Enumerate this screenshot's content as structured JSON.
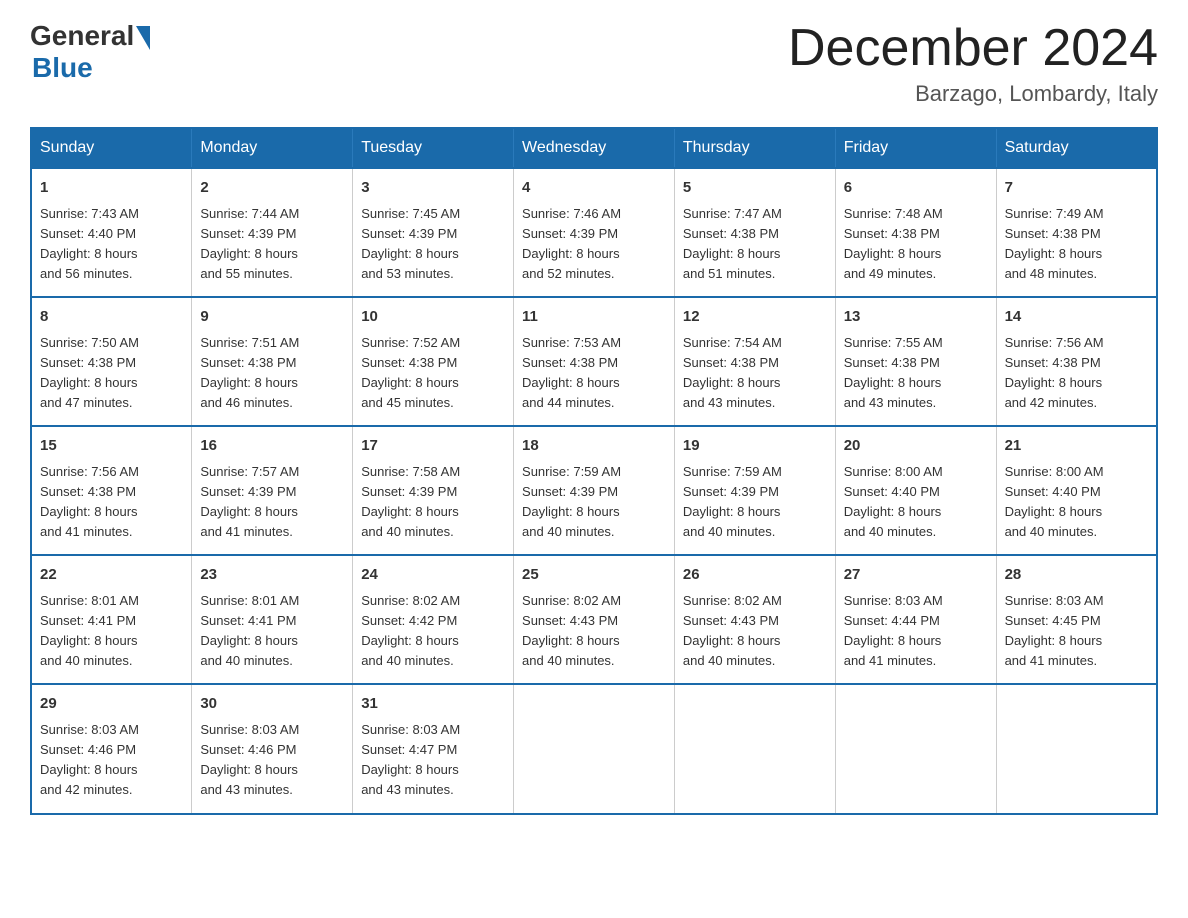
{
  "header": {
    "logo_general": "General",
    "logo_blue": "Blue",
    "month_title": "December 2024",
    "location": "Barzago, Lombardy, Italy"
  },
  "days_of_week": [
    "Sunday",
    "Monday",
    "Tuesday",
    "Wednesday",
    "Thursday",
    "Friday",
    "Saturday"
  ],
  "weeks": [
    [
      {
        "day": "1",
        "sunrise": "7:43 AM",
        "sunset": "4:40 PM",
        "daylight": "8 hours and 56 minutes."
      },
      {
        "day": "2",
        "sunrise": "7:44 AM",
        "sunset": "4:39 PM",
        "daylight": "8 hours and 55 minutes."
      },
      {
        "day": "3",
        "sunrise": "7:45 AM",
        "sunset": "4:39 PM",
        "daylight": "8 hours and 53 minutes."
      },
      {
        "day": "4",
        "sunrise": "7:46 AM",
        "sunset": "4:39 PM",
        "daylight": "8 hours and 52 minutes."
      },
      {
        "day": "5",
        "sunrise": "7:47 AM",
        "sunset": "4:38 PM",
        "daylight": "8 hours and 51 minutes."
      },
      {
        "day": "6",
        "sunrise": "7:48 AM",
        "sunset": "4:38 PM",
        "daylight": "8 hours and 49 minutes."
      },
      {
        "day": "7",
        "sunrise": "7:49 AM",
        "sunset": "4:38 PM",
        "daylight": "8 hours and 48 minutes."
      }
    ],
    [
      {
        "day": "8",
        "sunrise": "7:50 AM",
        "sunset": "4:38 PM",
        "daylight": "8 hours and 47 minutes."
      },
      {
        "day": "9",
        "sunrise": "7:51 AM",
        "sunset": "4:38 PM",
        "daylight": "8 hours and 46 minutes."
      },
      {
        "day": "10",
        "sunrise": "7:52 AM",
        "sunset": "4:38 PM",
        "daylight": "8 hours and 45 minutes."
      },
      {
        "day": "11",
        "sunrise": "7:53 AM",
        "sunset": "4:38 PM",
        "daylight": "8 hours and 44 minutes."
      },
      {
        "day": "12",
        "sunrise": "7:54 AM",
        "sunset": "4:38 PM",
        "daylight": "8 hours and 43 minutes."
      },
      {
        "day": "13",
        "sunrise": "7:55 AM",
        "sunset": "4:38 PM",
        "daylight": "8 hours and 43 minutes."
      },
      {
        "day": "14",
        "sunrise": "7:56 AM",
        "sunset": "4:38 PM",
        "daylight": "8 hours and 42 minutes."
      }
    ],
    [
      {
        "day": "15",
        "sunrise": "7:56 AM",
        "sunset": "4:38 PM",
        "daylight": "8 hours and 41 minutes."
      },
      {
        "day": "16",
        "sunrise": "7:57 AM",
        "sunset": "4:39 PM",
        "daylight": "8 hours and 41 minutes."
      },
      {
        "day": "17",
        "sunrise": "7:58 AM",
        "sunset": "4:39 PM",
        "daylight": "8 hours and 40 minutes."
      },
      {
        "day": "18",
        "sunrise": "7:59 AM",
        "sunset": "4:39 PM",
        "daylight": "8 hours and 40 minutes."
      },
      {
        "day": "19",
        "sunrise": "7:59 AM",
        "sunset": "4:39 PM",
        "daylight": "8 hours and 40 minutes."
      },
      {
        "day": "20",
        "sunrise": "8:00 AM",
        "sunset": "4:40 PM",
        "daylight": "8 hours and 40 minutes."
      },
      {
        "day": "21",
        "sunrise": "8:00 AM",
        "sunset": "4:40 PM",
        "daylight": "8 hours and 40 minutes."
      }
    ],
    [
      {
        "day": "22",
        "sunrise": "8:01 AM",
        "sunset": "4:41 PM",
        "daylight": "8 hours and 40 minutes."
      },
      {
        "day": "23",
        "sunrise": "8:01 AM",
        "sunset": "4:41 PM",
        "daylight": "8 hours and 40 minutes."
      },
      {
        "day": "24",
        "sunrise": "8:02 AM",
        "sunset": "4:42 PM",
        "daylight": "8 hours and 40 minutes."
      },
      {
        "day": "25",
        "sunrise": "8:02 AM",
        "sunset": "4:43 PM",
        "daylight": "8 hours and 40 minutes."
      },
      {
        "day": "26",
        "sunrise": "8:02 AM",
        "sunset": "4:43 PM",
        "daylight": "8 hours and 40 minutes."
      },
      {
        "day": "27",
        "sunrise": "8:03 AM",
        "sunset": "4:44 PM",
        "daylight": "8 hours and 41 minutes."
      },
      {
        "day": "28",
        "sunrise": "8:03 AM",
        "sunset": "4:45 PM",
        "daylight": "8 hours and 41 minutes."
      }
    ],
    [
      {
        "day": "29",
        "sunrise": "8:03 AM",
        "sunset": "4:46 PM",
        "daylight": "8 hours and 42 minutes."
      },
      {
        "day": "30",
        "sunrise": "8:03 AM",
        "sunset": "4:46 PM",
        "daylight": "8 hours and 43 minutes."
      },
      {
        "day": "31",
        "sunrise": "8:03 AM",
        "sunset": "4:47 PM",
        "daylight": "8 hours and 43 minutes."
      },
      null,
      null,
      null,
      null
    ]
  ],
  "labels": {
    "sunrise": "Sunrise:",
    "sunset": "Sunset:",
    "daylight": "Daylight:"
  }
}
